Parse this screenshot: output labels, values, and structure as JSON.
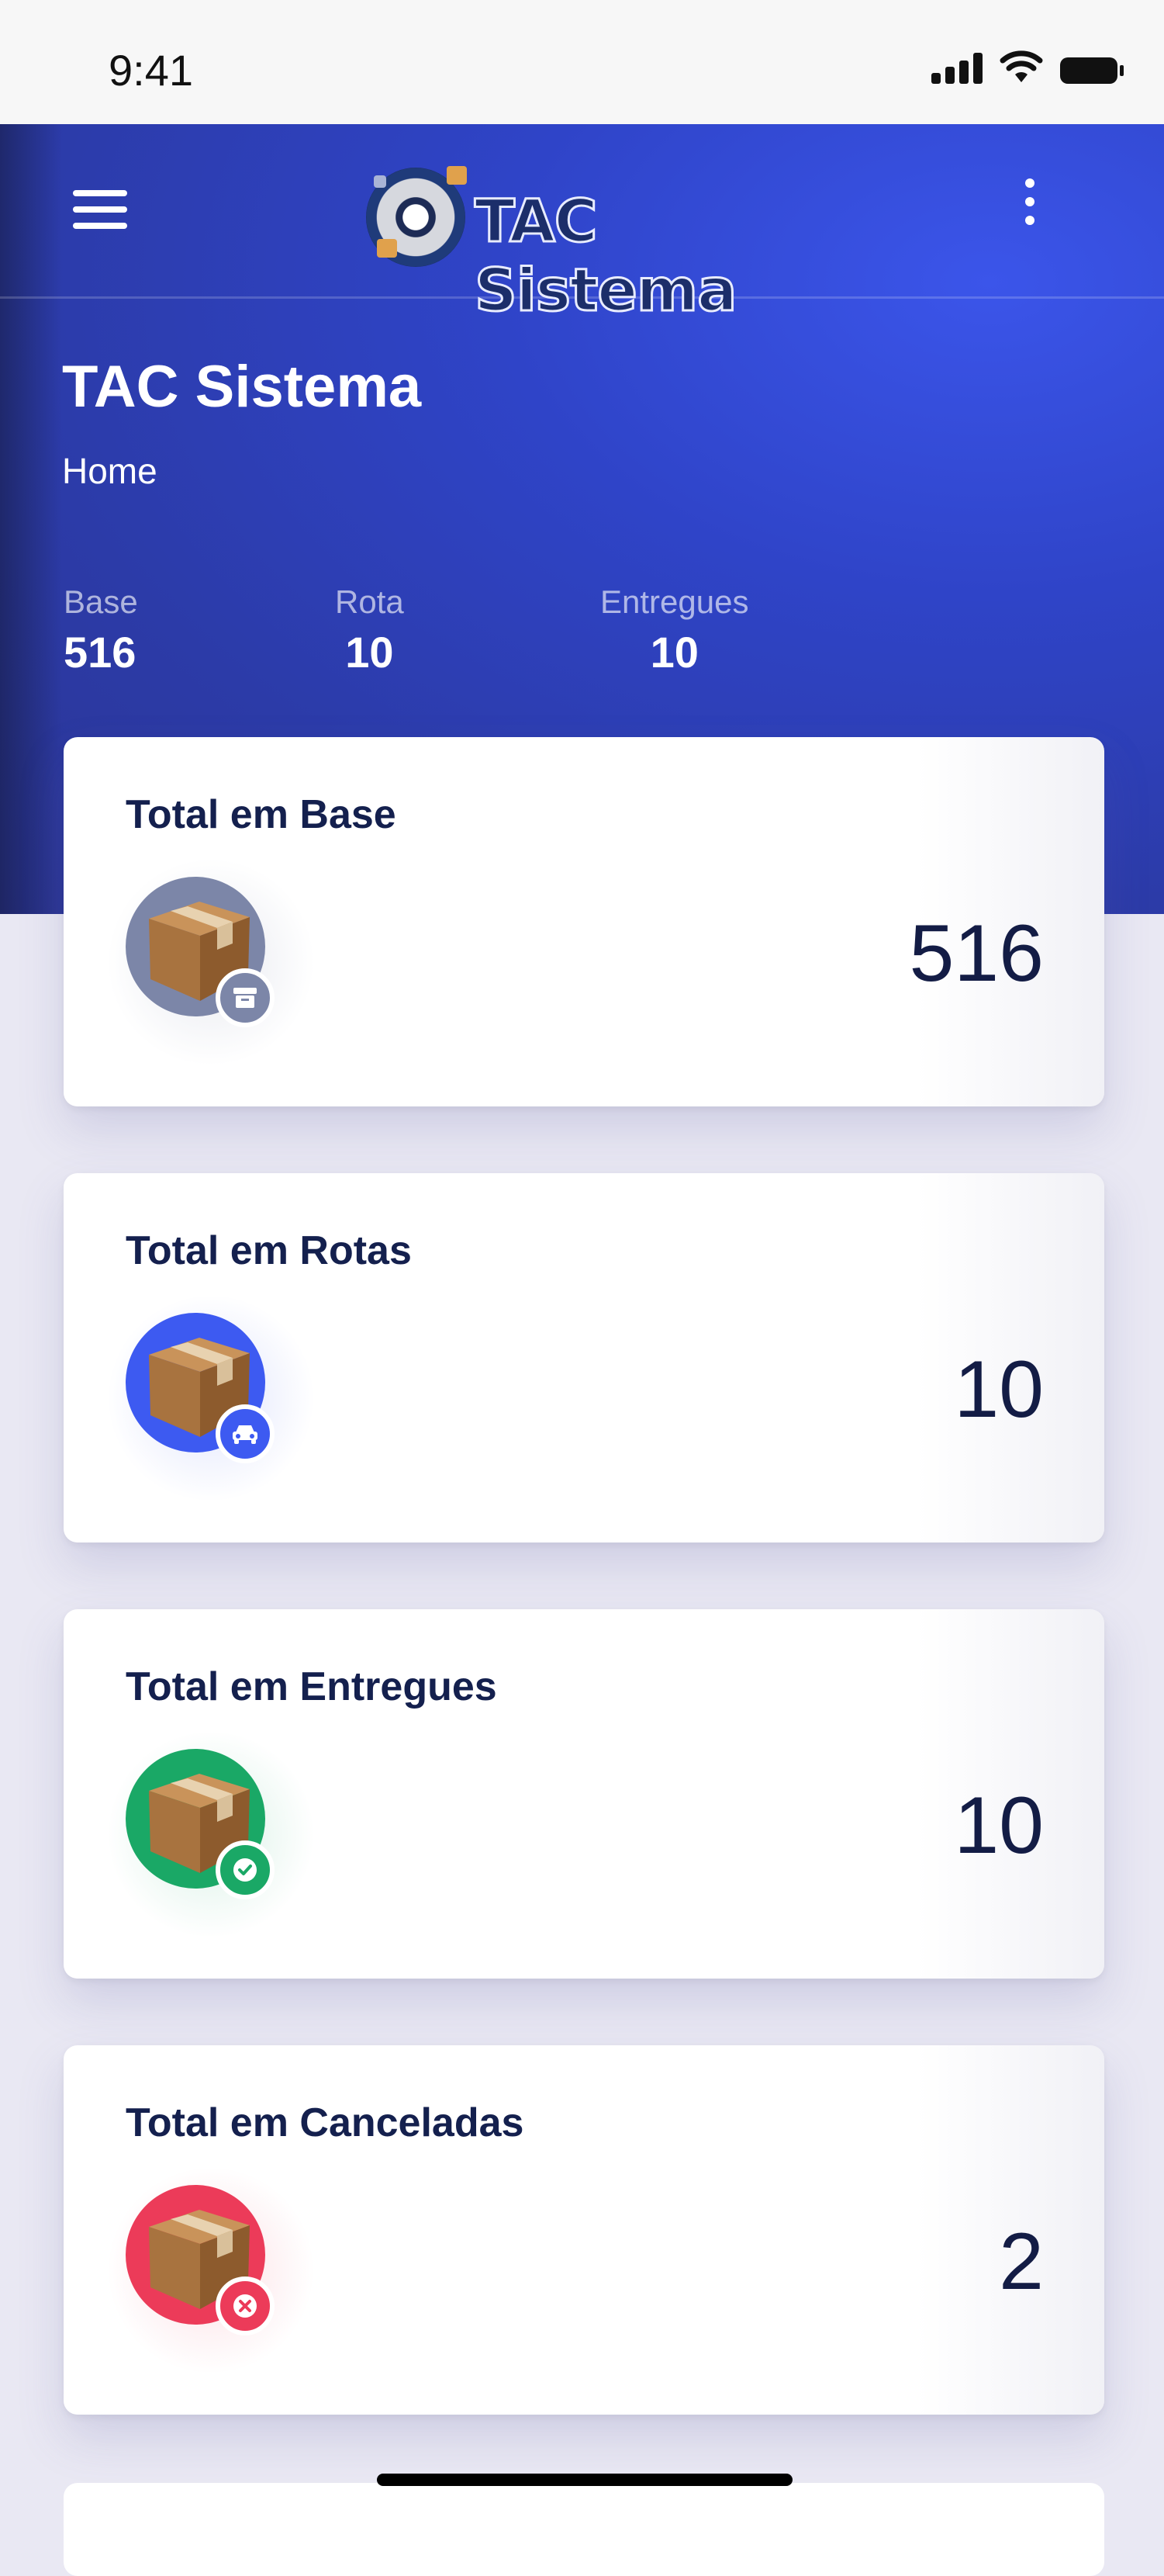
{
  "status_bar": {
    "time": "9:41"
  },
  "header": {
    "logo_text": "TAC Sistema",
    "menu_icon": "hamburger-menu-icon",
    "more_icon": "vertical-dots-icon"
  },
  "hero": {
    "title": "TAC Sistema",
    "breadcrumb": "Home",
    "stats": [
      {
        "label": "Base",
        "value": "516"
      },
      {
        "label": "Rota",
        "value": "10"
      },
      {
        "label": "Entregues",
        "value": "10"
      }
    ]
  },
  "cards": [
    {
      "title": "Total em Base",
      "value": "516",
      "color": "#7c86a8",
      "badge_icon": "archive-box-icon"
    },
    {
      "title": "Total em Rotas",
      "value": "10",
      "color": "#3d5af1",
      "badge_icon": "car-icon"
    },
    {
      "title": "Total em Entregues",
      "value": "10",
      "color": "#1aa866",
      "badge_icon": "check-circle-icon"
    },
    {
      "title": "Total em Canceladas",
      "value": "2",
      "color": "#ec3b59",
      "badge_icon": "x-circle-icon"
    }
  ]
}
